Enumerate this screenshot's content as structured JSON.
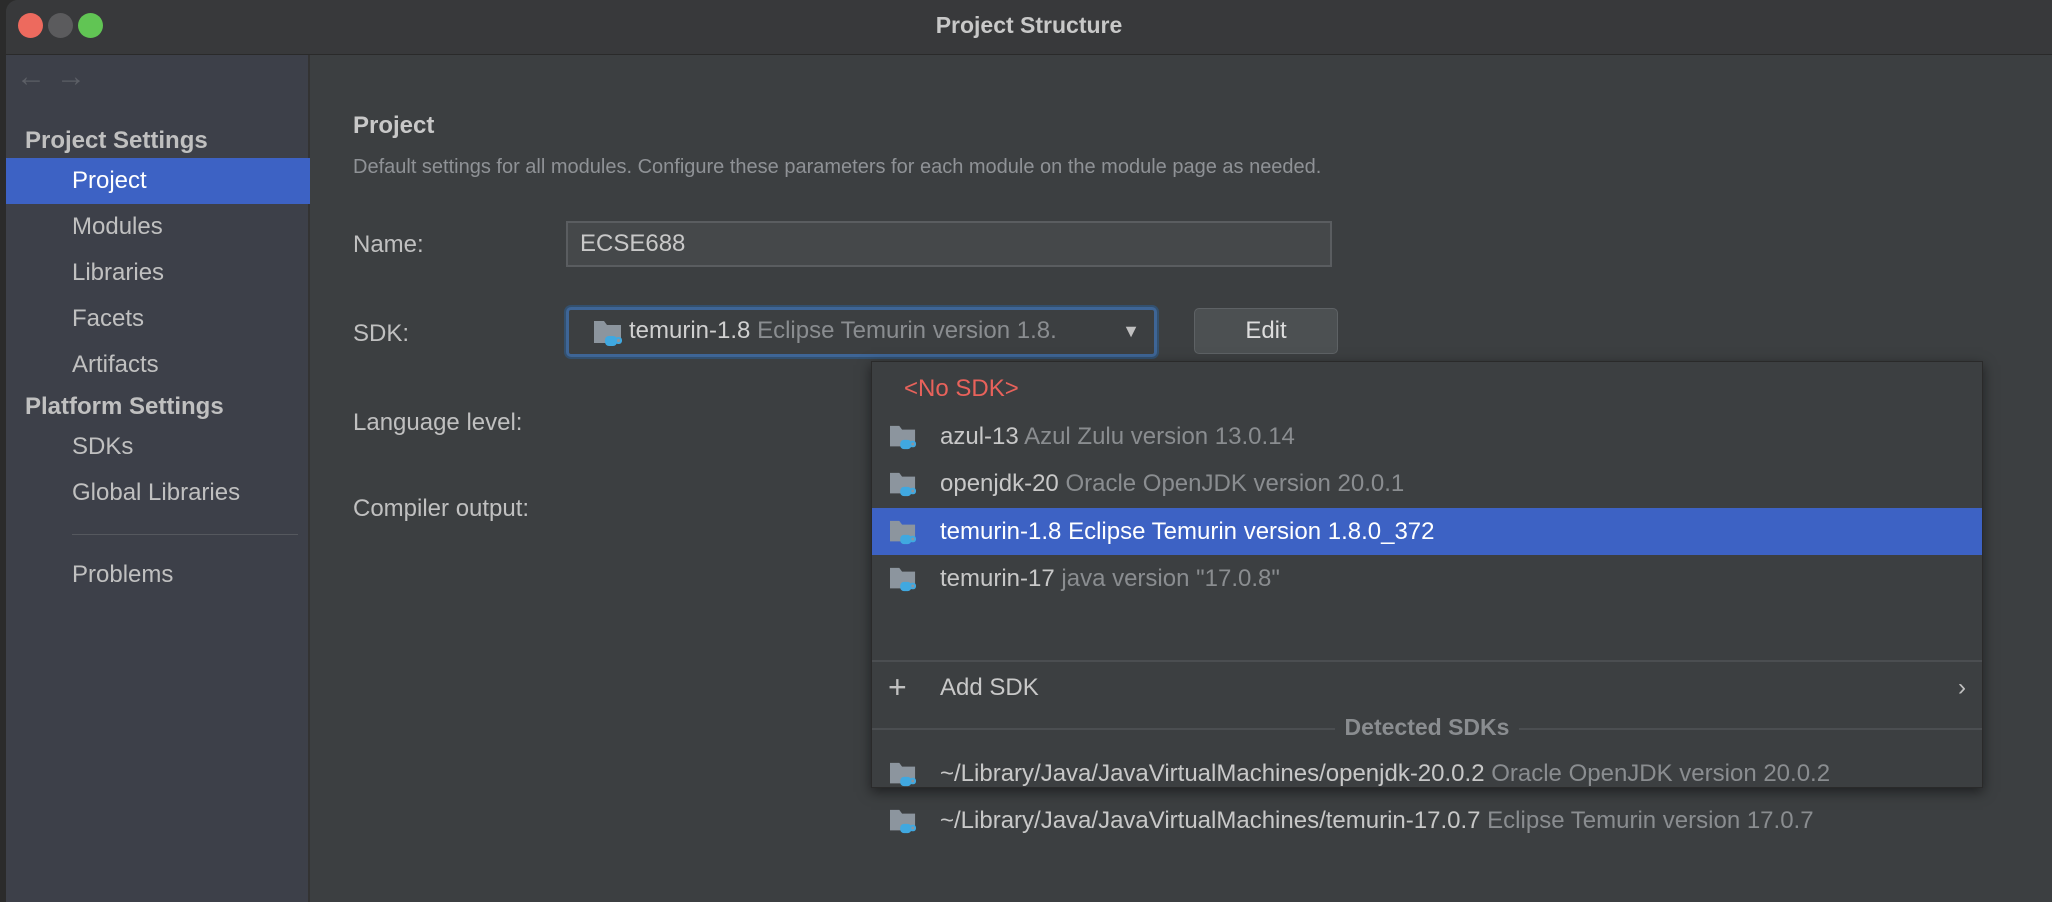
{
  "window": {
    "title": "Project Structure"
  },
  "sidebar": {
    "back": "←",
    "forward": "→",
    "project_settings_header": "Project Settings",
    "project_items": [
      "Project",
      "Modules",
      "Libraries",
      "Facets",
      "Artifacts"
    ],
    "platform_settings_header": "Platform Settings",
    "platform_items": [
      "SDKs",
      "Global Libraries"
    ],
    "problems": "Problems"
  },
  "main": {
    "heading": "Project",
    "description": "Default settings for all modules. Configure these parameters for each module on the module page as needed.",
    "name_label": "Name:",
    "name_value": "ECSE688",
    "sdk_label": "SDK:",
    "sdk_selected_name": "temurin-1.8",
    "sdk_selected_desc": "Eclipse Temurin version 1.8.",
    "edit_label": "Edit",
    "language_level_label": "Language level:",
    "compiler_output_label": "Compiler output:"
  },
  "popup": {
    "no_sdk": "<No SDK>",
    "sdks": [
      {
        "name": "azul-13",
        "desc": "Azul Zulu version 13.0.14"
      },
      {
        "name": "openjdk-20",
        "desc": "Oracle OpenJDK version 20.0.1"
      },
      {
        "name": "temurin-1.8",
        "desc": "Eclipse Temurin version 1.8.0_372"
      },
      {
        "name": "temurin-17",
        "desc": "java version \"17.0.8\""
      }
    ],
    "add_sdk": "Add SDK",
    "detected_header": "Detected SDKs",
    "detected": [
      {
        "name": "~/Library/Java/JavaVirtualMachines/openjdk-20.0.2",
        "desc": "Oracle OpenJDK version 20.0.2"
      },
      {
        "name": "~/Library/Java/JavaVirtualMachines/temurin-17.0.7",
        "desc": "Eclipse Temurin version 17.0.7"
      }
    ]
  },
  "colors": {
    "accent": "#3d62c4",
    "no_sdk": "#e8625b",
    "close": "#ed6a5e",
    "minimize": "#5b5b5d",
    "zoom": "#61c554"
  }
}
